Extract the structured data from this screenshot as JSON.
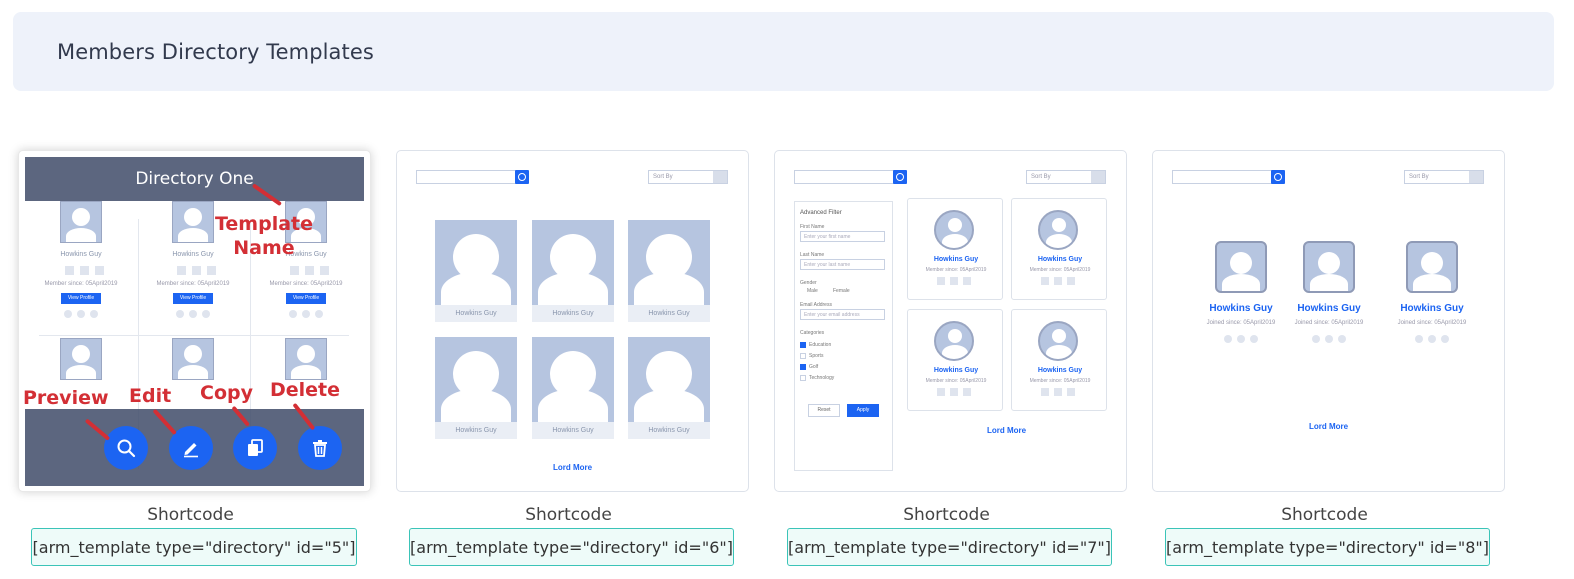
{
  "header": {
    "title": "Members Directory Templates"
  },
  "templates": [
    {
      "name": "Directory One",
      "label": "Shortcode",
      "shortcode": "[arm_template type=\"directory\" id=\"5\"]"
    },
    {
      "label": "Shortcode",
      "shortcode": "[arm_template type=\"directory\" id=\"6\"]"
    },
    {
      "label": "Shortcode",
      "shortcode": "[arm_template type=\"directory\" id=\"7\"]"
    },
    {
      "label": "Shortcode",
      "shortcode": "[arm_template type=\"directory\" id=\"8\"]"
    }
  ],
  "annotations": {
    "template_name": "Template Name",
    "preview": "Preview",
    "edit": "Edit",
    "copy": "Copy",
    "delete": "Delete"
  },
  "preview": {
    "member_name": "Howkins Guy",
    "member_since": "Member since: 05April2019",
    "joined_since": "Joined since: 05April2019",
    "view_profile": "View Profile",
    "load_more": "Lord More",
    "sort_by": "Sort By",
    "advanced_filter": "Advanced Filter",
    "first_name": "First Name",
    "first_name_ph": "Enter your first name",
    "last_name": "Last Name",
    "last_name_ph": "Enter your last name",
    "gender": "Gender",
    "male": "Male",
    "female": "Female",
    "email": "Email Address",
    "email_ph": "Enter your email address",
    "categories": "Categories",
    "cats": [
      "Education",
      "Sports",
      "Golf",
      "Technology"
    ],
    "reset": "Reset",
    "apply": "Apply"
  },
  "colors": {
    "accent": "#1c64f2",
    "annotation": "#d32f35",
    "shortcode_border": "#3bc4b8"
  }
}
